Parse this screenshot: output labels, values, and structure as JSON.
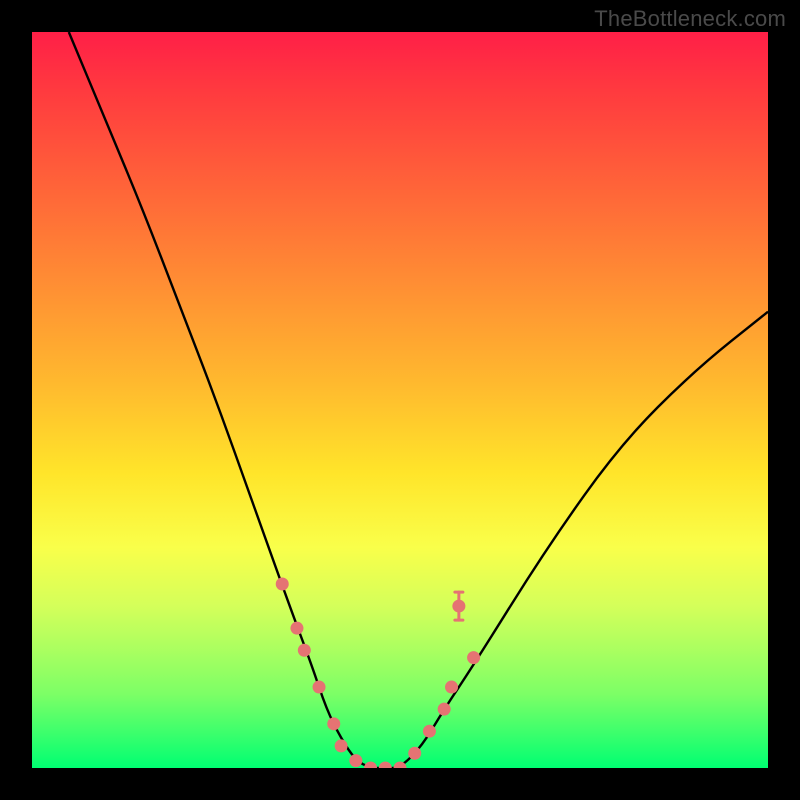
{
  "watermark": "TheBottleneck.com",
  "colors": {
    "page_bg": "#000000",
    "curve": "#000000",
    "marker": "#e57373",
    "gradient_top": "#ff1f47",
    "gradient_mid": "#ffe52a",
    "gradient_bottom": "#00ff72"
  },
  "chart_data": {
    "type": "line",
    "title": "",
    "xlabel": "",
    "ylabel": "",
    "xlim": [
      0,
      100
    ],
    "ylim": [
      0,
      100
    ],
    "legend": false,
    "grid": false,
    "note": "Axes are unlabeled in the source image; values are read off the 0–100 plot-area percent grid.",
    "series": [
      {
        "name": "bottleneck-curve",
        "color": "#000000",
        "x": [
          5,
          10,
          15,
          20,
          25,
          30,
          35,
          38,
          40,
          42,
          44,
          46,
          48,
          50,
          53,
          56,
          60,
          70,
          80,
          90,
          100
        ],
        "y": [
          100,
          88,
          76,
          63,
          50,
          36,
          22,
          14,
          8,
          4,
          1,
          0,
          0,
          0,
          3,
          8,
          14,
          30,
          44,
          54,
          62
        ]
      }
    ],
    "markers": {
      "comment": "coral dot/i-beam markers clustered near the valley",
      "color": "#e57373",
      "points": [
        {
          "x": 34,
          "y": 25
        },
        {
          "x": 36,
          "y": 19
        },
        {
          "x": 37,
          "y": 16
        },
        {
          "x": 39,
          "y": 11
        },
        {
          "x": 41,
          "y": 6
        },
        {
          "x": 42,
          "y": 3
        },
        {
          "x": 44,
          "y": 1
        },
        {
          "x": 46,
          "y": 0
        },
        {
          "x": 48,
          "y": 0
        },
        {
          "x": 50,
          "y": 0
        },
        {
          "x": 52,
          "y": 2
        },
        {
          "x": 54,
          "y": 5
        },
        {
          "x": 56,
          "y": 8
        },
        {
          "x": 57,
          "y": 11
        },
        {
          "x": 60,
          "y": 15
        },
        {
          "x": 58,
          "y": 22
        }
      ]
    }
  }
}
